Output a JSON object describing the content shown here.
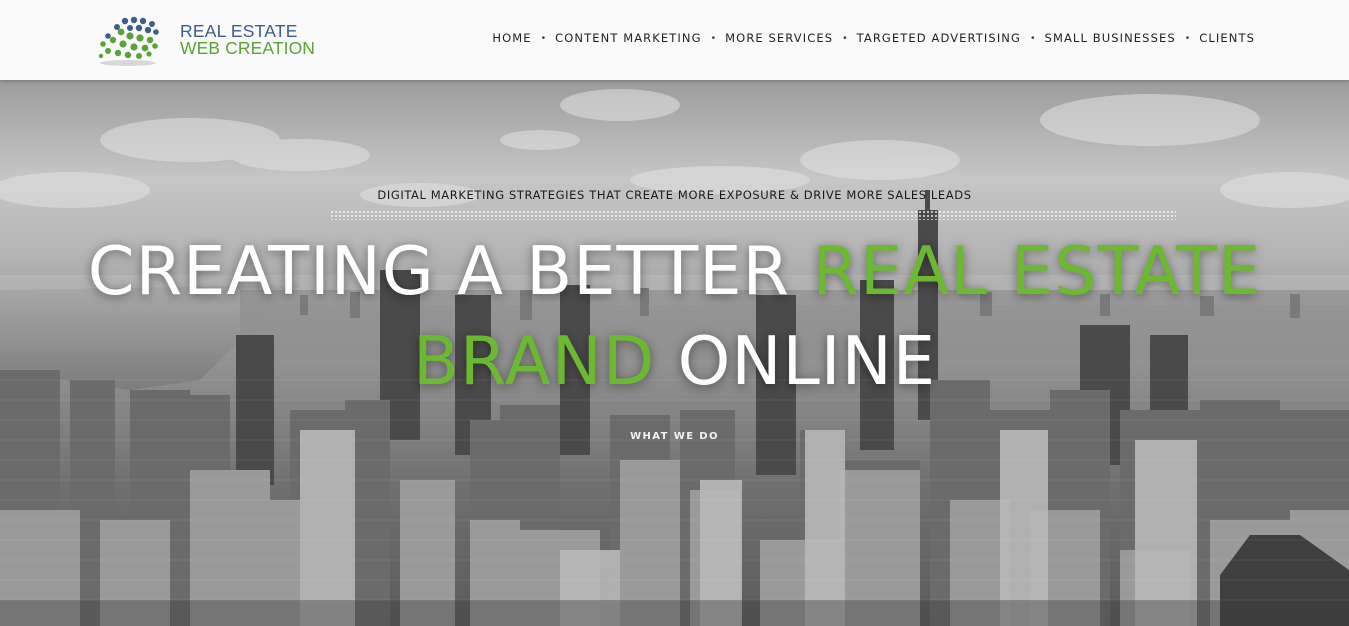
{
  "brand": {
    "line1": "REAL ESTATE",
    "line2": "WEB CREATION",
    "icon": "dotted-globe-logo",
    "colors": {
      "blue": "#3d5e86",
      "green": "#5aa23a"
    }
  },
  "nav": {
    "items": [
      {
        "label": "HOME"
      },
      {
        "label": "CONTENT MARKETING"
      },
      {
        "label": "MORE SERVICES"
      },
      {
        "label": "TARGETED ADVERTISING"
      },
      {
        "label": "SMALL BUSINESSES"
      },
      {
        "label": "CLIENTS"
      }
    ],
    "separator": "•"
  },
  "hero": {
    "tagline": "DIGITAL MARKETING STRATEGIES THAT CREATE MORE EXPOSURE & DRIVE MORE SALES LEADS",
    "headline": {
      "part1": "CREATING A BETTER ",
      "part2": "REAL ESTATE BRAND",
      "part3": " ONLINE"
    },
    "cta": "WHAT WE DO",
    "background": "black-and-white-city-skyline",
    "accent_color": "#6cb832"
  }
}
